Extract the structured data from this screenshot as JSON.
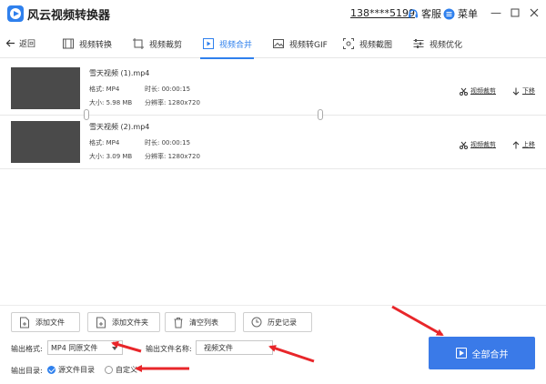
{
  "titlebar": {
    "app_title": "风云视频转换器",
    "account": "138****5199",
    "service_label": "客服",
    "menu_label": "菜单"
  },
  "nav": {
    "back_label": "返回",
    "tabs": [
      {
        "label": "视频转换",
        "icon": "film-icon"
      },
      {
        "label": "视频裁剪",
        "icon": "crop-icon"
      },
      {
        "label": "视频合并",
        "icon": "merge-icon",
        "active": true
      },
      {
        "label": "视频转GIF",
        "icon": "image-icon"
      },
      {
        "label": "视频截图",
        "icon": "screenshot-icon"
      },
      {
        "label": "视频优化",
        "icon": "sliders-icon"
      }
    ]
  },
  "files": [
    {
      "name": "雪天视频 (1).mp4",
      "format": "格式: MP4",
      "duration": "时长: 00:00:15",
      "size": "大小: 5.98 MB",
      "resolution": "分辨率: 1280x720",
      "edit_label": "视频裁剪",
      "move_label": "下移"
    },
    {
      "name": "雪天视频 (2).mp4",
      "format": "格式: MP4",
      "duration": "时长: 00:00:15",
      "size": "大小: 3.09 MB",
      "resolution": "分辨率: 1280x720",
      "edit_label": "视频裁剪",
      "move_label": "上移"
    }
  ],
  "toolbar": {
    "add_file": "添加文件",
    "add_folder": "添加文件夹",
    "clear_list": "清空列表",
    "history": "历史记录",
    "format_label": "输出格式:",
    "format_value": "MP4 同原文件",
    "name_label": "输出文件名称:",
    "name_value": "视频文件",
    "dir_label": "输出目录:",
    "dir_source": "源文件目录",
    "dir_custom": "自定义",
    "merge_button": "全部合并"
  },
  "colors": {
    "accent": "#2f80ed",
    "merge_button": "#3a7ae8",
    "annotation": "#e8262a",
    "thumbnail": "#4a4a4a"
  }
}
